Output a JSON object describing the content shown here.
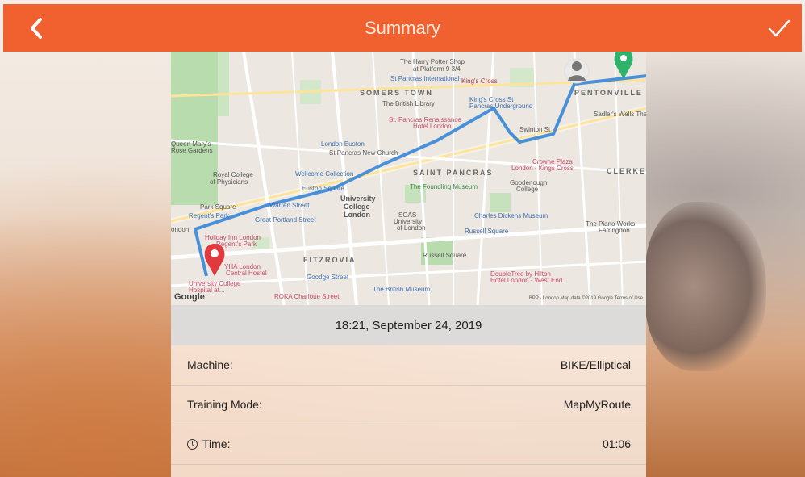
{
  "header": {
    "title": "Summary",
    "back_icon": "chevron-left-icon",
    "confirm_icon": "check-icon",
    "accent_color": "#f0612f"
  },
  "map": {
    "labels": {
      "somers_town": "SOMERS TOWN",
      "pentonville": "PENTONVILLE",
      "saint_pancras": "SAINT PANCRAS",
      "clerken": "CLERKEN",
      "fitzrovia": "FITZROVIA",
      "harry_potter": "The Harry Potter Shop",
      "platform": "at Platform 9 3/4",
      "st_pancras_intl": "St Pancras International",
      "kings_cross": "King's Cross",
      "british_library": "The British Library",
      "kings_cross_st": "King's Cross St",
      "pancras_underground": "Pancras Underground",
      "renaissance": "St. Pancras Renaissance",
      "renaissance2": "Hotel London",
      "london_euston": "London Euston",
      "st_pancras_church": "St Pancras New Church",
      "wellcome": "Wellcome Collection",
      "euston_sq": "Euston Square",
      "ucl": "University",
      "ucl2": "College",
      "ucl3": "London",
      "foundling": "The Foundling Museum",
      "royal_college": "Royal College",
      "royal_college2": "of Physicians",
      "park_square": "Park Square",
      "regents_park": "Regent's Park",
      "great_portland": "Great Portland Street",
      "warren_st": "Warren Street",
      "holiday_inn": "Holiday Inn London",
      "holiday_inn2": "Regent's Park",
      "yha": "YHA London",
      "yha2": "Central Hostel",
      "uch": "University College",
      "uch2": "Hospital at...",
      "goodge": "Goodge Street",
      "roka": "ROKA Charlotte Street",
      "british_museum": "The British Museum",
      "russell_sq_station": "Russell Square",
      "russell_square": "Russell Square",
      "soas": "SOAS",
      "soas2": "University",
      "soas3": "of London",
      "dickens": "Charles Dickens Museum",
      "piano": "The Piano Works",
      "piano2": "Farringdon",
      "goodenough": "Goodenough",
      "goodenough2": "College",
      "crowne": "Crowne Plaza",
      "crowne2": "London - Kings Cross",
      "doubletree": "DoubleTree by Hilton",
      "doubletree2": "Hotel London - West End",
      "sadlers": "Sadler's Wells Theatre",
      "swinton": "Swinton St",
      "queen_mary": "Queen Mary's",
      "queen_mary2": "Rose Gardens",
      "london_left": "ondon",
      "google": "Google",
      "copyright": "BPP - London  Map data ©2019 Google  Terms of Use"
    },
    "start_pin_color": "#e0393e",
    "end_pin_color": "#2fb36a",
    "route_color": "#4a90d9"
  },
  "summary": {
    "datetime": "18:21, September 24, 2019",
    "rows": [
      {
        "label": "Machine:",
        "value": "BIKE/Elliptical"
      },
      {
        "label": "Training Mode:",
        "value": "MapMyRoute"
      },
      {
        "label": "Time:",
        "value": "01:06",
        "icon": "clock-icon"
      }
    ]
  }
}
